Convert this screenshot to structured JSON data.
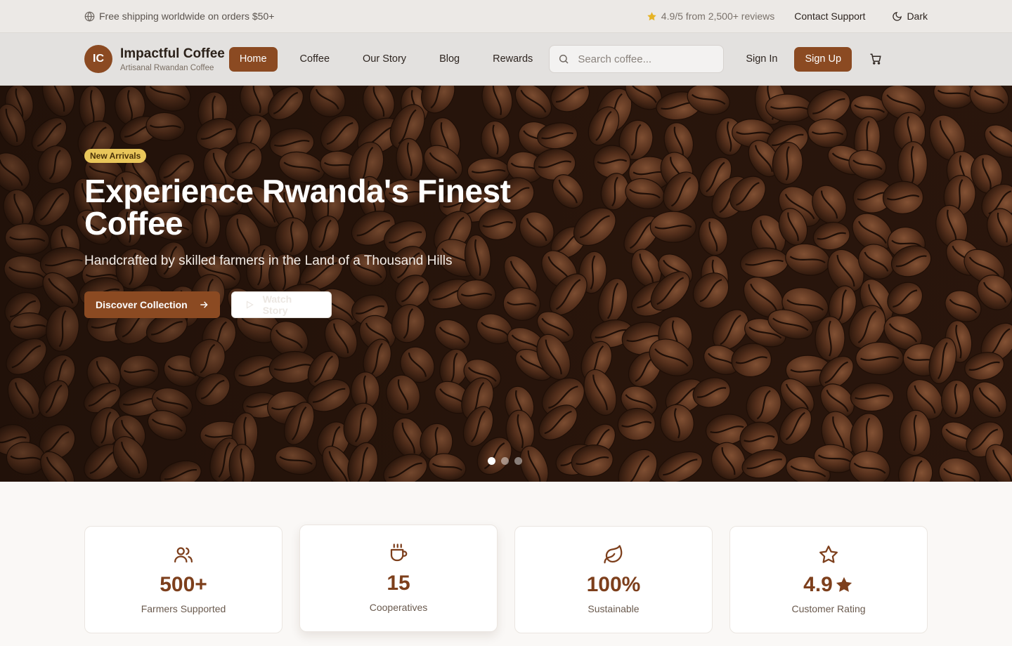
{
  "topbar": {
    "shipping": "Free shipping worldwide on orders $50+",
    "rating": "4.9/5 from 2,500+ reviews",
    "support": "Contact Support",
    "theme_toggle": "Dark"
  },
  "brand": {
    "initials": "IC",
    "name": "Impactful Coffee",
    "tagline": "Artisanal Rwandan Coffee"
  },
  "nav": {
    "items": [
      {
        "label": "Home",
        "active": true
      },
      {
        "label": "Coffee"
      },
      {
        "label": "Our Story"
      },
      {
        "label": "Blog"
      },
      {
        "label": "Rewards"
      }
    ]
  },
  "search": {
    "placeholder": "Search coffee..."
  },
  "auth": {
    "sign_in": "Sign In",
    "sign_up": "Sign Up"
  },
  "hero": {
    "badge": "New Arrivals",
    "title_line1": "Experience Rwanda's Finest",
    "title_line2": "Coffee",
    "subtitle": "Handcrafted by skilled farmers in the Land of a Thousand Hills",
    "primary_cta": "Discover Collection",
    "secondary_cta": "Watch Story",
    "slides": 3,
    "active_slide": 1
  },
  "stats": [
    {
      "icon": "users-icon",
      "value": "500+",
      "label": "Farmers Supported"
    },
    {
      "icon": "coffee-cup-icon",
      "value": "15",
      "label": "Cooperatives"
    },
    {
      "icon": "leaf-icon",
      "value": "100%",
      "label": "Sustainable"
    },
    {
      "icon": "star-outline-icon",
      "value": "4.9",
      "label": "Customer Rating"
    }
  ],
  "colors": {
    "brand": "#8b4a22",
    "stat_value": "#7d3f1c",
    "badge": "#e9c65a",
    "star": "#e6b325"
  }
}
